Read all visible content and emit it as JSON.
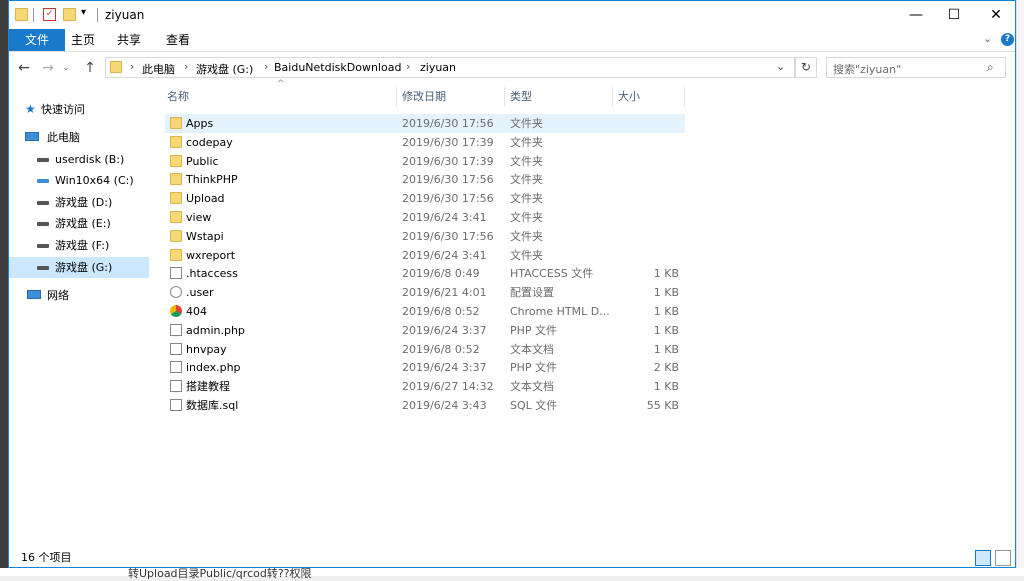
{
  "window": {
    "title": "ziyuan"
  },
  "ribbon": {
    "tabs": [
      "文件",
      "主页",
      "共享",
      "查看"
    ]
  },
  "address": {
    "crumbs": [
      "此电脑",
      "游戏盘 (G:)",
      "BaiduNetdiskDownload",
      "ziyuan"
    ]
  },
  "search": {
    "placeholder": "搜索\"ziyuan\""
  },
  "nav": {
    "items": [
      {
        "label": "快速访问",
        "icon": "star-icon"
      },
      {
        "label": "此电脑",
        "icon": "computer-icon"
      },
      {
        "label": "userdisk (B:)",
        "icon": "drive-icon"
      },
      {
        "label": "Win10x64 (C:)",
        "icon": "system-drive-icon"
      },
      {
        "label": "游戏盘 (D:)",
        "icon": "drive-icon"
      },
      {
        "label": "游戏盘 (E:)",
        "icon": "drive-icon"
      },
      {
        "label": "游戏盘 (F:)",
        "icon": "drive-icon"
      },
      {
        "label": "游戏盘 (G:)",
        "icon": "drive-icon"
      },
      {
        "label": "网络",
        "icon": "network-icon"
      }
    ]
  },
  "columns": {
    "name": "名称",
    "date": "修改日期",
    "type": "类型",
    "size": "大小"
  },
  "files": [
    {
      "name": "Apps",
      "date": "2019/6/30 17:56",
      "type": "文件夹",
      "size": "",
      "icon": "folder-icon"
    },
    {
      "name": "codepay",
      "date": "2019/6/30 17:39",
      "type": "文件夹",
      "size": "",
      "icon": "folder-icon"
    },
    {
      "name": "Public",
      "date": "2019/6/30 17:39",
      "type": "文件夹",
      "size": "",
      "icon": "folder-icon"
    },
    {
      "name": "ThinkPHP",
      "date": "2019/6/30 17:56",
      "type": "文件夹",
      "size": "",
      "icon": "folder-icon"
    },
    {
      "name": "Upload",
      "date": "2019/6/30 17:56",
      "type": "文件夹",
      "size": "",
      "icon": "folder-icon"
    },
    {
      "name": "view",
      "date": "2019/6/24 3:41",
      "type": "文件夹",
      "size": "",
      "icon": "folder-icon"
    },
    {
      "name": "Wstapi",
      "date": "2019/6/30 17:56",
      "type": "文件夹",
      "size": "",
      "icon": "folder-icon"
    },
    {
      "name": "wxreport",
      "date": "2019/6/24 3:41",
      "type": "文件夹",
      "size": "",
      "icon": "folder-icon"
    },
    {
      "name": ".htaccess",
      "date": "2019/6/8 0:49",
      "type": "HTACCESS 文件",
      "size": "1 KB",
      "icon": "file-icon"
    },
    {
      "name": ".user",
      "date": "2019/6/21 4:01",
      "type": "配置设置",
      "size": "1 KB",
      "icon": "settings-file-icon"
    },
    {
      "name": "404",
      "date": "2019/6/8 0:52",
      "type": "Chrome HTML D...",
      "size": "1 KB",
      "icon": "chrome-icon"
    },
    {
      "name": "admin.php",
      "date": "2019/6/24 3:37",
      "type": "PHP 文件",
      "size": "1 KB",
      "icon": "file-icon"
    },
    {
      "name": "hnvpay",
      "date": "2019/6/8 0:52",
      "type": "文本文档",
      "size": "1 KB",
      "icon": "file-icon"
    },
    {
      "name": "index.php",
      "date": "2019/6/24 3:37",
      "type": "PHP 文件",
      "size": "2 KB",
      "icon": "file-icon"
    },
    {
      "name": "搭建教程",
      "date": "2019/6/27 14:32",
      "type": "文本文档",
      "size": "1 KB",
      "icon": "file-icon"
    },
    {
      "name": "数据库.sql",
      "date": "2019/6/24 3:43",
      "type": "SQL 文件",
      "size": "55 KB",
      "icon": "file-icon"
    }
  ],
  "status": {
    "count": "16 个项目"
  },
  "background": {
    "text": "转Upload目录Public/qrcod转??权限"
  },
  "colors": {
    "accent": "#1979ca",
    "selection": "#e5f3ff",
    "folder": "#f8d775"
  }
}
